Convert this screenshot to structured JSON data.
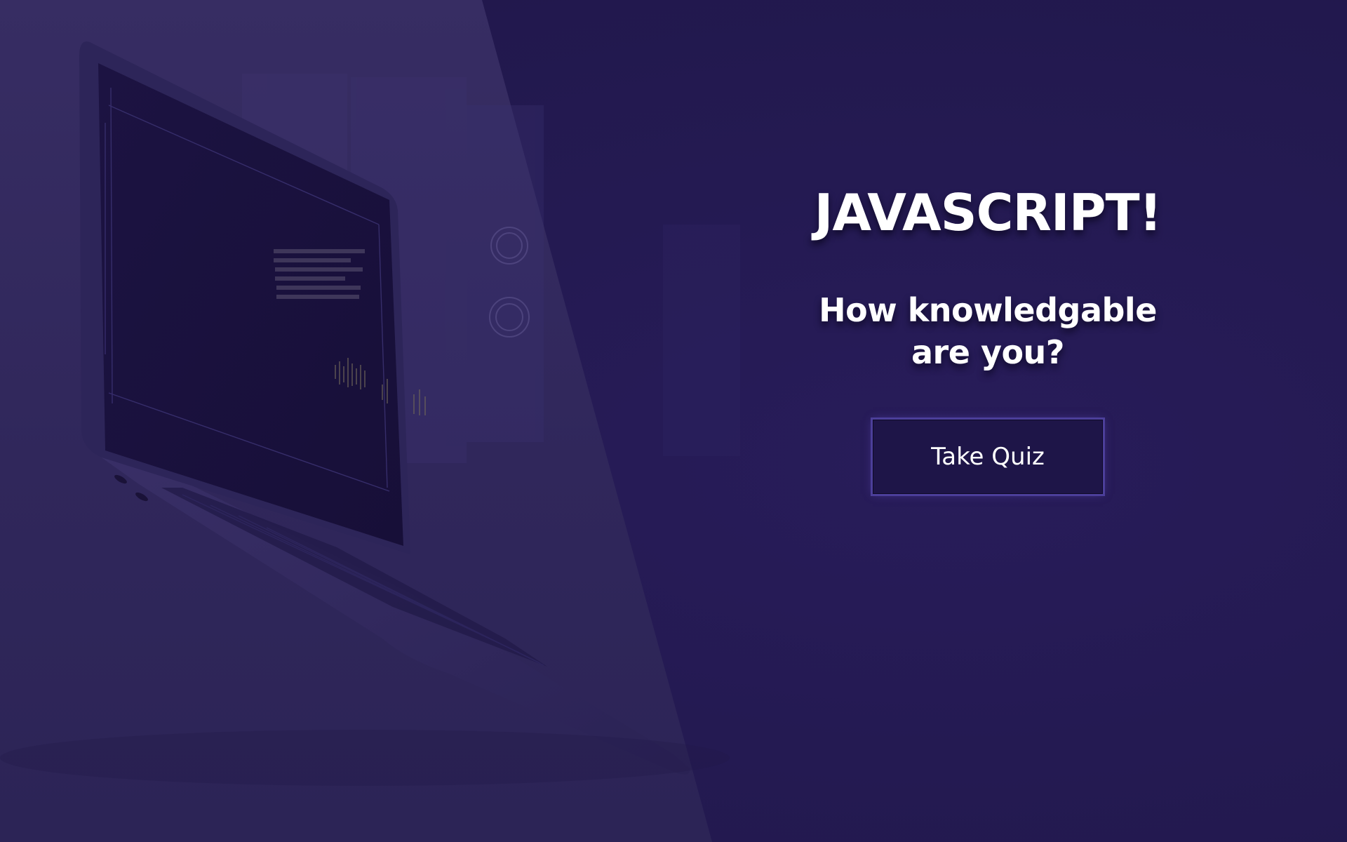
{
  "hero": {
    "title": "JAVASCRIPT!",
    "subtitle_line1": "How knowledgable",
    "subtitle_line2": "are you?",
    "cta_label": "Take Quiz"
  },
  "background": {
    "illustration": "laptop-illustration",
    "base_color": "#241a52",
    "panel_color": "#332a5f"
  },
  "colors": {
    "text": "#ffffff",
    "button_fill": "#1e1548",
    "button_glow": "#4c3f9a",
    "screen": "#1b1240"
  }
}
